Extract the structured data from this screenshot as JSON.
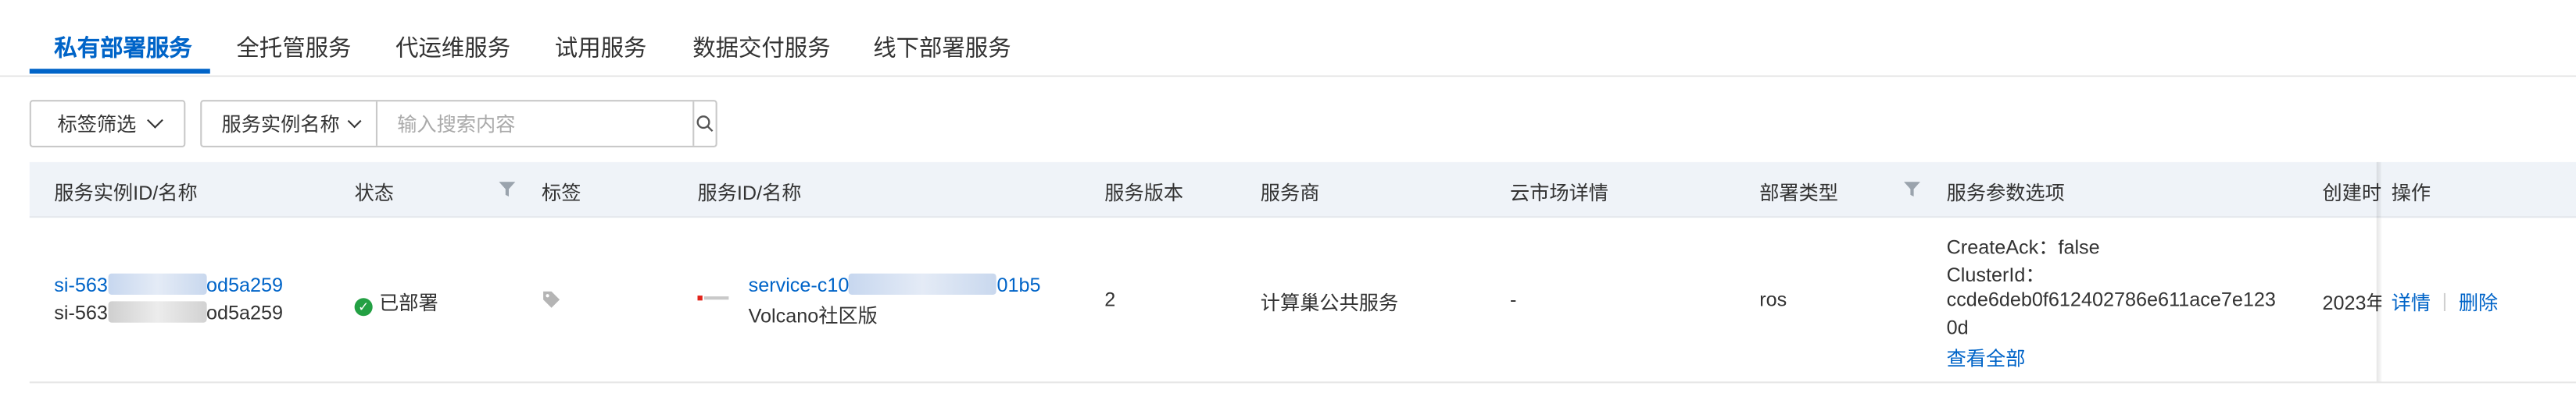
{
  "tabs": [
    {
      "label": "私有部署服务",
      "active": true
    },
    {
      "label": "全托管服务"
    },
    {
      "label": "代运维服务"
    },
    {
      "label": "试用服务"
    },
    {
      "label": "数据交付服务"
    },
    {
      "label": "线下部署服务"
    }
  ],
  "filters": {
    "tag_filter_label": "标签筛选",
    "search_field_select": "服务实例名称",
    "search_placeholder": "输入搜索内容",
    "search_value": ""
  },
  "table": {
    "columns": [
      "服务实例ID/名称",
      "状态",
      "标签",
      "服务ID/名称",
      "服务版本",
      "服务商",
      "云市场详情",
      "部署类型",
      "服务参数选项",
      "创建时",
      "操作"
    ],
    "rows": [
      {
        "instance_id_prefix": "si-563",
        "instance_id_suffix": "od5a259",
        "instance_name_prefix": "si-563",
        "instance_name_suffix": "od5a259",
        "status": "已部署",
        "service_id_prefix": "service-c10",
        "service_id_suffix": "01b5",
        "service_name": "Volcano社区版",
        "version": "2",
        "provider": "计算巢公共服务",
        "market_detail": "-",
        "deploy_type": "ros",
        "params": {
          "line1": "CreateAck：false",
          "line2": "ClusterId：",
          "line3": "ccde6deb0f612402786e611ace7e123",
          "line4": "0d",
          "view_all": "查看全部"
        },
        "created_prefix": "2023年",
        "actions": {
          "detail": "详情",
          "delete": "删除"
        }
      }
    ]
  },
  "colors": {
    "accent": "#0064c8",
    "status_ok": "#23a043",
    "header_bg": "#eff3f8"
  }
}
